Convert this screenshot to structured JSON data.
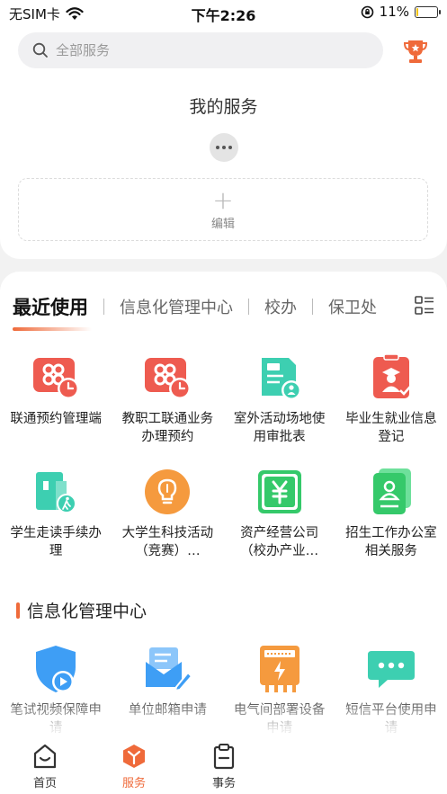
{
  "status_bar": {
    "carrier": "无SIM卡",
    "time": "下午2:26",
    "battery": "11%",
    "battery_level": 0.11
  },
  "search": {
    "placeholder": "全部服务"
  },
  "my_services": {
    "title": "我的服务",
    "edit_label": "编辑"
  },
  "tabs": [
    {
      "label": "最近使用",
      "active": true
    },
    {
      "label": "信息化管理中心"
    },
    {
      "label": "校办"
    },
    {
      "label": "保卫处"
    }
  ],
  "recent": [
    {
      "name": "联通预约管理端",
      "icon": "unicom-calendar-icon"
    },
    {
      "name": "教职工联通业务办理预约",
      "icon": "unicom-calendar-icon"
    },
    {
      "name": "室外活动场地使用审批表",
      "icon": "venue-approval-icon"
    },
    {
      "name": "毕业生就业信息登记",
      "icon": "graduate-card-icon"
    },
    {
      "name": "学生走读手续办理",
      "icon": "walking-building-icon"
    },
    {
      "name": "大学生科技活动（竞赛）…",
      "icon": "lightbulb-icon"
    },
    {
      "name": "资产经营公司（校办产业…",
      "icon": "yuan-asset-icon"
    },
    {
      "name": "招生工作办公室相关服务",
      "icon": "id-card-icon"
    }
  ],
  "section": {
    "title": "信息化管理中心"
  },
  "info_center": [
    {
      "name": "笔试视频保障申请",
      "icon": "shield-play-icon"
    },
    {
      "name": "单位邮箱申请",
      "icon": "mail-edit-icon"
    },
    {
      "name": "电气间部署设备申请",
      "icon": "electric-box-icon"
    },
    {
      "name": "短信平台使用申请",
      "icon": "sms-bubble-icon"
    }
  ],
  "bottom_nav": [
    {
      "label": "首页",
      "icon": "home-icon"
    },
    {
      "label": "服务",
      "icon": "service-cube-icon",
      "active": true
    },
    {
      "label": "事务",
      "icon": "clipboard-icon"
    }
  ],
  "colors": {
    "accent": "#ef6a3a",
    "red_icon": "#ee5b50",
    "teal_icon": "#3dcfb1",
    "green_icon": "#35c96a",
    "orange_icon": "#f59a3e",
    "blue_icon": "#3e9ef5"
  }
}
